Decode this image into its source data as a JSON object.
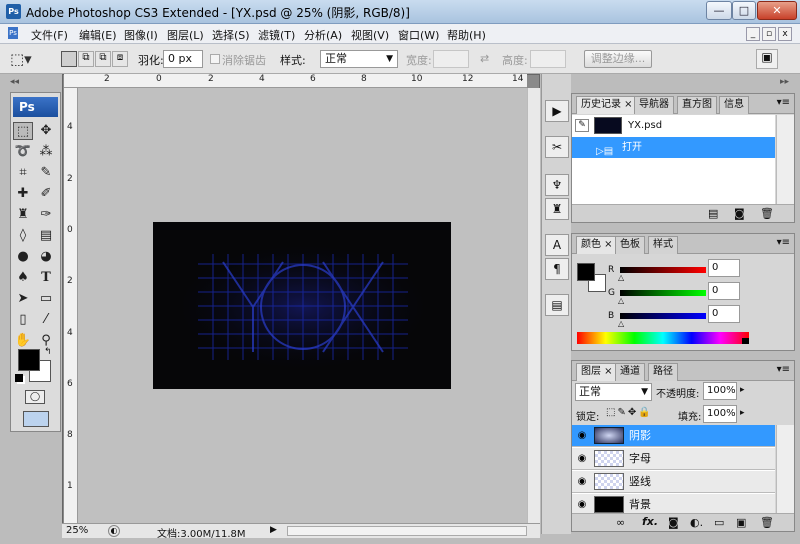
{
  "window": {
    "title": "Adobe Photoshop CS3 Extended - [YX.psd @ 25% (阴影, RGB/8)]",
    "app_icon_label": "Ps",
    "minimize_glyph": "—",
    "maximize_glyph": "□",
    "close_glyph": "✕"
  },
  "menubar": {
    "items": [
      "文件(F)",
      "编辑(E)",
      "图像(I)",
      "图层(L)",
      "选择(S)",
      "滤镜(T)",
      "分析(A)",
      "视图(V)",
      "窗口(W)",
      "帮助(H)"
    ],
    "doc_min": "_",
    "doc_restore": "▫",
    "doc_close": "x"
  },
  "options": {
    "feather_label": "羽化:",
    "feather_value": "0 px",
    "antialias_label": "消除锯齿",
    "style_label": "样式:",
    "style_value": "正常",
    "width_label": "宽度:",
    "height_label": "高度:",
    "refine_edge_button": "调整边缘..."
  },
  "toolbox": {
    "logo": "Ps"
  },
  "rulers": {
    "top": [
      "2",
      "0",
      "2",
      "4",
      "6",
      "8",
      "10",
      "12",
      "14"
    ],
    "left": [
      "4",
      "2",
      "0",
      "2",
      "4",
      "6",
      "8",
      "1"
    ]
  },
  "status": {
    "zoom": "25%",
    "doc_info": "文档:3.00M/11.8M"
  },
  "history_panel": {
    "tabs": [
      "历史记录",
      "导航器",
      "直方图",
      "信息"
    ],
    "snapshot_name": "YX.psd",
    "steps": [
      "打开"
    ]
  },
  "color_panel": {
    "tabs": [
      "颜色",
      "色板",
      "样式"
    ],
    "channels": [
      {
        "label": "R",
        "value": "0"
      },
      {
        "label": "G",
        "value": "0"
      },
      {
        "label": "B",
        "value": "0"
      }
    ]
  },
  "layers_panel": {
    "tabs": [
      "图层",
      "通道",
      "路径"
    ],
    "blend_mode": "正常",
    "opacity_label": "不透明度:",
    "opacity_value": "100%",
    "lock_label": "锁定:",
    "fill_label": "填充:",
    "fill_value": "100%",
    "layers": [
      {
        "name": "阴影",
        "selected": true
      },
      {
        "name": "字母",
        "selected": false
      },
      {
        "name": "竖线",
        "selected": false
      },
      {
        "name": "背景",
        "selected": false
      }
    ]
  },
  "colors": {
    "selection_blue": "#3399ff",
    "artwork_grid": "#1a2bb5",
    "foreground": "#000000",
    "background": "#ffffff"
  }
}
